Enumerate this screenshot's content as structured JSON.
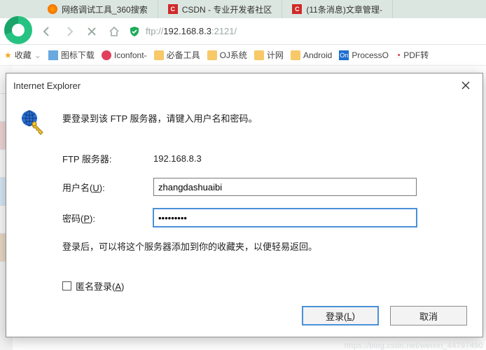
{
  "tabs": [
    {
      "title": "网络调试工具_360搜索",
      "fav": "360"
    },
    {
      "title": "CSDN - 专业开发者社区",
      "fav": "csdn"
    },
    {
      "title": "(11条消息)文章管理-",
      "fav": "csdn"
    }
  ],
  "address": {
    "scheme": "ftp://",
    "host": "192.168.8.3",
    "port": ":2121/"
  },
  "bookmarks": {
    "fav_label": "收藏",
    "items": [
      {
        "label": "图标下载",
        "icon": "img"
      },
      {
        "label": "Iconfont-",
        "icon": "iconfont"
      },
      {
        "label": "必备工具",
        "icon": "folder"
      },
      {
        "label": "OJ系统",
        "icon": "folder"
      },
      {
        "label": "计网",
        "icon": "folder"
      },
      {
        "label": "Android",
        "icon": "folder"
      },
      {
        "label": "ProcessO",
        "icon": "on"
      },
      {
        "label": "PDF转",
        "icon": "pdf"
      }
    ]
  },
  "dialog": {
    "title": "Internet Explorer",
    "message": "要登录到该 FTP 服务器，请键入用户名和密码。",
    "server_label": "FTP 服务器:",
    "server_value": "192.168.8.3",
    "user_label_pre": "用户名(",
    "user_key": "U",
    "user_label_post": "):",
    "user_value": "zhangdashuaibi",
    "pass_label_pre": "密码(",
    "pass_key": "P",
    "pass_label_post": "):",
    "pass_value": "•••••••••",
    "note": "登录后，可以将这个服务器添加到你的收藏夹，以便轻易返回。",
    "anon_pre": "匿名登录(",
    "anon_key": "A",
    "anon_post": ")",
    "login_btn_pre": "登录(",
    "login_key": "L",
    "login_btn_post": ")",
    "cancel_btn": "取消"
  },
  "watermark": "https://blog.csdn.net/weixin_44797490"
}
